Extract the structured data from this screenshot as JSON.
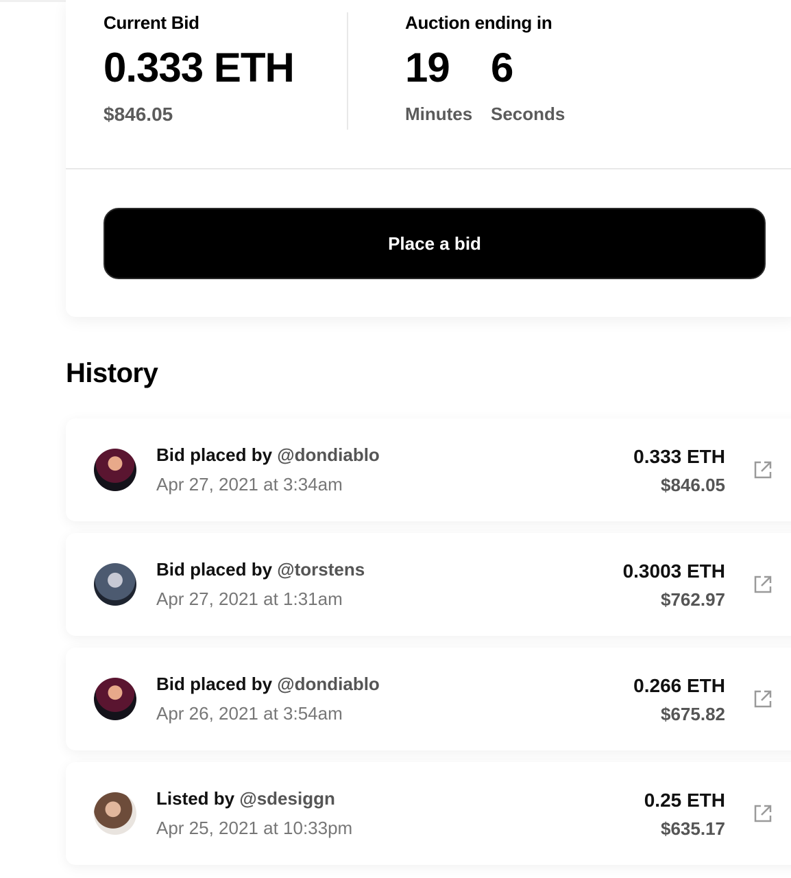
{
  "current_bid": {
    "label": "Current Bid",
    "eth": "0.333 ETH",
    "usd": "$846.05"
  },
  "auction": {
    "label": "Auction ending in",
    "minutes_value": "19",
    "minutes_label": "Minutes",
    "seconds_value": "6",
    "seconds_label": "Seconds"
  },
  "bid_button_label": "Place a bid",
  "history": {
    "title": "History",
    "items": [
      {
        "prefix": "Bid placed by ",
        "handle": "@dondiablo",
        "date": "Apr 27, 2021 at 3:34am",
        "eth": "0.333 ETH",
        "usd": "$846.05",
        "avatar_icon": "user-avatar"
      },
      {
        "prefix": "Bid placed by ",
        "handle": "@torstens",
        "date": "Apr 27, 2021 at 1:31am",
        "eth": "0.3003 ETH",
        "usd": "$762.97",
        "avatar_icon": "user-avatar"
      },
      {
        "prefix": "Bid placed by ",
        "handle": "@dondiablo",
        "date": "Apr 26, 2021 at 3:54am",
        "eth": "0.266 ETH",
        "usd": "$675.82",
        "avatar_icon": "user-avatar"
      },
      {
        "prefix": "Listed by ",
        "handle": "@sdesiggn",
        "date": "Apr 25, 2021 at 10:33pm",
        "eth": "0.25 ETH",
        "usd": "$635.17",
        "avatar_icon": "user-avatar"
      }
    ]
  },
  "icons": {
    "external_link": "external-link-icon"
  }
}
